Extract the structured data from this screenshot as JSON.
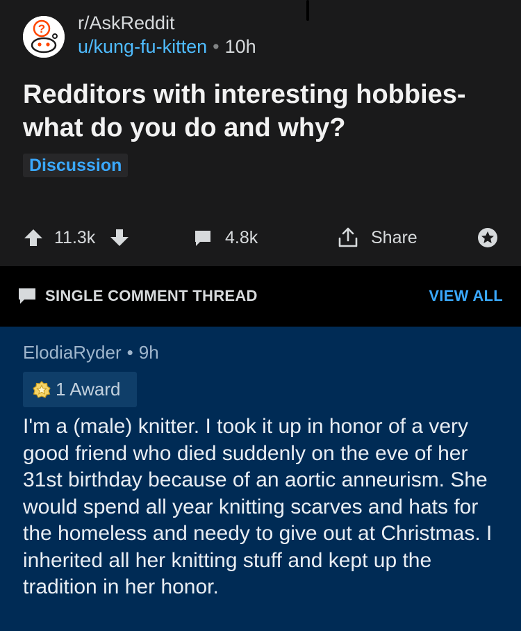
{
  "post": {
    "subreddit": "r/AskReddit",
    "author": "u/kung-fu-kitten",
    "separator": "•",
    "age": "10h",
    "title": "Redditors with interesting hobbies- what do you do and why?",
    "flair": "Discussion",
    "upvotes": "11.3k",
    "comments": "4.8k",
    "share_label": "Share"
  },
  "thread_bar": {
    "label": "SINGLE COMMENT THREAD",
    "view_all": "VIEW ALL"
  },
  "comment": {
    "author": "ElodiaRyder",
    "separator": "•",
    "age": "9h",
    "award_label": "1 Award",
    "body": "I'm a (male) knitter. I took it up in honor of a very good friend who died suddenly on the eve of her 31st birthday because of an aortic anneurism. She would spend all year knitting scarves and hats for the homeless and needy to give out at Christmas. I inherited all her knitting stuff and kept up the tradition in her honor."
  },
  "colors": {
    "background": "#1a1a1b",
    "link_blue": "#4fbcff",
    "accent_blue": "#3aa8ff",
    "comment_bg": "#002b55"
  }
}
